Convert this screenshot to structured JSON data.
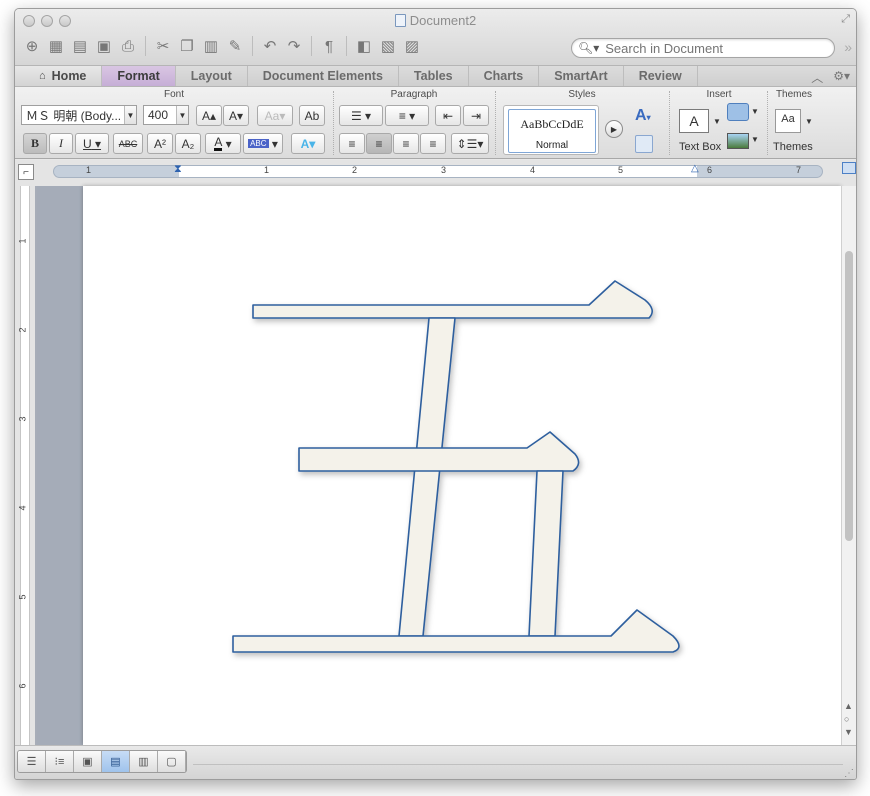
{
  "window": {
    "title": "Document2"
  },
  "search": {
    "placeholder": "Search in Document"
  },
  "ribbon_tabs": [
    "Home",
    "Format",
    "Layout",
    "Document Elements",
    "Tables",
    "Charts",
    "SmartArt",
    "Review"
  ],
  "active_tab": "Format",
  "groups": {
    "font": {
      "title": "Font",
      "font_name": "ＭＳ 明朝 (Body...",
      "font_size": "400",
      "bold": "B",
      "italic": "I",
      "underline": "U",
      "strike": "ABC",
      "superscript": "A²",
      "subscript": "A₂",
      "grow": "A",
      "shrink": "A"
    },
    "paragraph": {
      "title": "Paragraph"
    },
    "styles": {
      "title": "Styles",
      "sample": "AaBbCcDdE",
      "current_style": "Normal"
    },
    "insert": {
      "title": "Insert",
      "text_box_label": "Text Box"
    },
    "themes": {
      "title": "Themes",
      "themes_label": "Themes",
      "sample": "Aa"
    }
  },
  "ruler": {
    "h_numbers": [
      "1",
      "1",
      "2",
      "3",
      "4",
      "5",
      "6",
      "7"
    ],
    "v_numbers": [
      "1",
      "2",
      "3",
      "4",
      "5",
      "6"
    ]
  },
  "document": {
    "text": "五"
  },
  "colors": {
    "active_tab": "#c6aed6",
    "glyph_fill": "#f4f2ea",
    "glyph_stroke": "#2d5f9e",
    "page_bg": "#a5acb8",
    "selected_view": "#9fc3ec"
  }
}
